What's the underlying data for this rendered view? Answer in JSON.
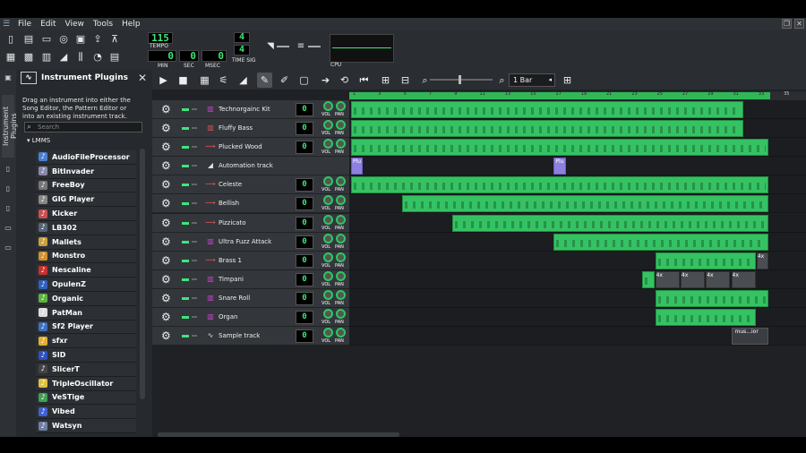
{
  "menu": [
    "File",
    "Edit",
    "View",
    "Tools",
    "Help"
  ],
  "transport": {
    "tempo": "115",
    "tempo_label": "TEMPO",
    "min": "0",
    "sec": "0",
    "msec": "0",
    "min_label": "MIN",
    "sec_label": "SEC",
    "msec_label": "MSEC",
    "timesig_top": "4",
    "timesig_bottom": "4",
    "timesig_label": "TIME SIG",
    "cpu_label": "CPU"
  },
  "plugins": {
    "title": "Instrument Plugins",
    "side_tab": "Instrument Plugins",
    "description": "Drag an instrument into either the Song Editor, the Pattern Editor or into an existing instrument track.",
    "search_placeholder": "Search",
    "tree_root": "LMMS",
    "items": [
      {
        "label": "AudioFileProcessor",
        "icon": "waveform-icon",
        "color": "#4a7fd0"
      },
      {
        "label": "BitInvader",
        "icon": "bitinvader-icon",
        "color": "#8888aa"
      },
      {
        "label": "FreeBoy",
        "icon": "gameboy-icon",
        "color": "#777777"
      },
      {
        "label": "GIG Player",
        "icon": "gig-icon",
        "color": "#888888"
      },
      {
        "label": "Kicker",
        "icon": "kicker-icon",
        "color": "#c85050"
      },
      {
        "label": "LB302",
        "icon": "lb302-icon",
        "color": "#556677"
      },
      {
        "label": "Mallets",
        "icon": "mallets-icon",
        "color": "#c8a040"
      },
      {
        "label": "Monstro",
        "icon": "monstro-icon",
        "color": "#d09030"
      },
      {
        "label": "Nescaline",
        "icon": "nes-icon",
        "color": "#c83030"
      },
      {
        "label": "OpulenZ",
        "icon": "opulenz-icon",
        "color": "#3060c0"
      },
      {
        "label": "Organic",
        "icon": "organic-icon",
        "color": "#60b040"
      },
      {
        "label": "PatMan",
        "icon": "patman-icon",
        "color": "#dddddd"
      },
      {
        "label": "Sf2 Player",
        "icon": "sf2-icon",
        "color": "#4070c0"
      },
      {
        "label": "sfxr",
        "icon": "star-icon",
        "color": "#e0b030"
      },
      {
        "label": "SID",
        "icon": "sid-icon",
        "color": "#3050c0"
      },
      {
        "label": "SlicerT",
        "icon": "slicert-icon",
        "color": "#444444"
      },
      {
        "label": "TripleOscillator",
        "icon": "triple-osc-icon",
        "color": "#e0c040"
      },
      {
        "label": "VeSTige",
        "icon": "vestige-icon",
        "color": "#40a050"
      },
      {
        "label": "Vibed",
        "icon": "vibed-icon",
        "color": "#4060d0"
      },
      {
        "label": "Watsyn",
        "icon": "watsyn-icon",
        "color": "#7080a0"
      }
    ]
  },
  "editor": {
    "snap": "1 Bar",
    "bar_numbers": [
      "1",
      "3",
      "5",
      "7",
      "9",
      "11",
      "13",
      "15",
      "17",
      "19",
      "21",
      "23",
      "25",
      "27",
      "29",
      "31",
      "33",
      "35",
      "37"
    ],
    "tracks": [
      {
        "name": "Technorgainc Kit",
        "kind": "instrument",
        "vol": "0",
        "icon": "kit-icon",
        "patterns": [
          {
            "start": 1,
            "len": 31
          }
        ]
      },
      {
        "name": "Fluffy Bass",
        "kind": "instrument",
        "vol": "0",
        "icon": "bass-icon",
        "patterns": [
          {
            "start": 1,
            "len": 31
          }
        ]
      },
      {
        "name": "Plucked Wood",
        "kind": "instrument",
        "vol": "0",
        "icon": "pluck-icon",
        "patterns": [
          {
            "start": 1,
            "len": 33
          }
        ]
      },
      {
        "name": "Automation track",
        "kind": "automation",
        "icon": "automation-icon",
        "patterns": [
          {
            "start": 1,
            "len": 1,
            "label": "Plu",
            "auto": true
          },
          {
            "start": 17,
            "len": 1,
            "label": "Plu",
            "auto": true
          }
        ]
      },
      {
        "name": "Celeste",
        "kind": "instrument",
        "vol": "0",
        "icon": "pluck-icon",
        "patterns": [
          {
            "start": 1,
            "len": 33
          }
        ]
      },
      {
        "name": "Bellish",
        "kind": "instrument",
        "vol": "0",
        "icon": "pluck-icon",
        "patterns": [
          {
            "start": 5,
            "len": 29
          }
        ]
      },
      {
        "name": "Pizzicato",
        "kind": "instrument",
        "vol": "0",
        "icon": "pluck-icon",
        "patterns": [
          {
            "start": 9,
            "len": 25
          }
        ]
      },
      {
        "name": "Ultra Fuzz Attack",
        "kind": "instrument",
        "vol": "0",
        "icon": "synth-icon",
        "patterns": [
          {
            "start": 17,
            "len": 17
          }
        ]
      },
      {
        "name": "Brass 1",
        "kind": "instrument",
        "vol": "0",
        "icon": "pluck-icon",
        "patterns": [
          {
            "start": 25,
            "len": 8
          },
          {
            "start": 33,
            "len": 1,
            "beat": true,
            "label": "4x"
          }
        ]
      },
      {
        "name": "Timpani",
        "kind": "instrument",
        "vol": "0",
        "icon": "synth-icon",
        "patterns": [
          {
            "start": 24,
            "len": 1
          },
          {
            "start": 25,
            "len": 2,
            "beat": true,
            "label": "4x"
          },
          {
            "start": 27,
            "len": 2,
            "beat": true,
            "label": "4x"
          },
          {
            "start": 29,
            "len": 2,
            "beat": true,
            "label": "4x"
          },
          {
            "start": 31,
            "len": 2,
            "beat": true,
            "label": "4x"
          }
        ]
      },
      {
        "name": "Snare Roll",
        "kind": "instrument",
        "vol": "0",
        "icon": "synth-icon",
        "patterns": [
          {
            "start": 25,
            "len": 9
          }
        ]
      },
      {
        "name": "Organ",
        "kind": "instrument",
        "vol": "0",
        "icon": "synth-icon",
        "patterns": [
          {
            "start": 25,
            "len": 8
          }
        ]
      },
      {
        "name": "Sample track",
        "kind": "sample",
        "vol": "0",
        "icon": "waveform-icon",
        "patterns": [
          {
            "start": 31,
            "len": 3,
            "label": "mus...ior",
            "smp": true
          }
        ]
      }
    ]
  },
  "labels": {
    "vol": "VOL",
    "pan": "PAN"
  },
  "colors": {
    "accent": "#35c263",
    "automation": "#8f7fe0",
    "lcd": "#3ee57a"
  }
}
